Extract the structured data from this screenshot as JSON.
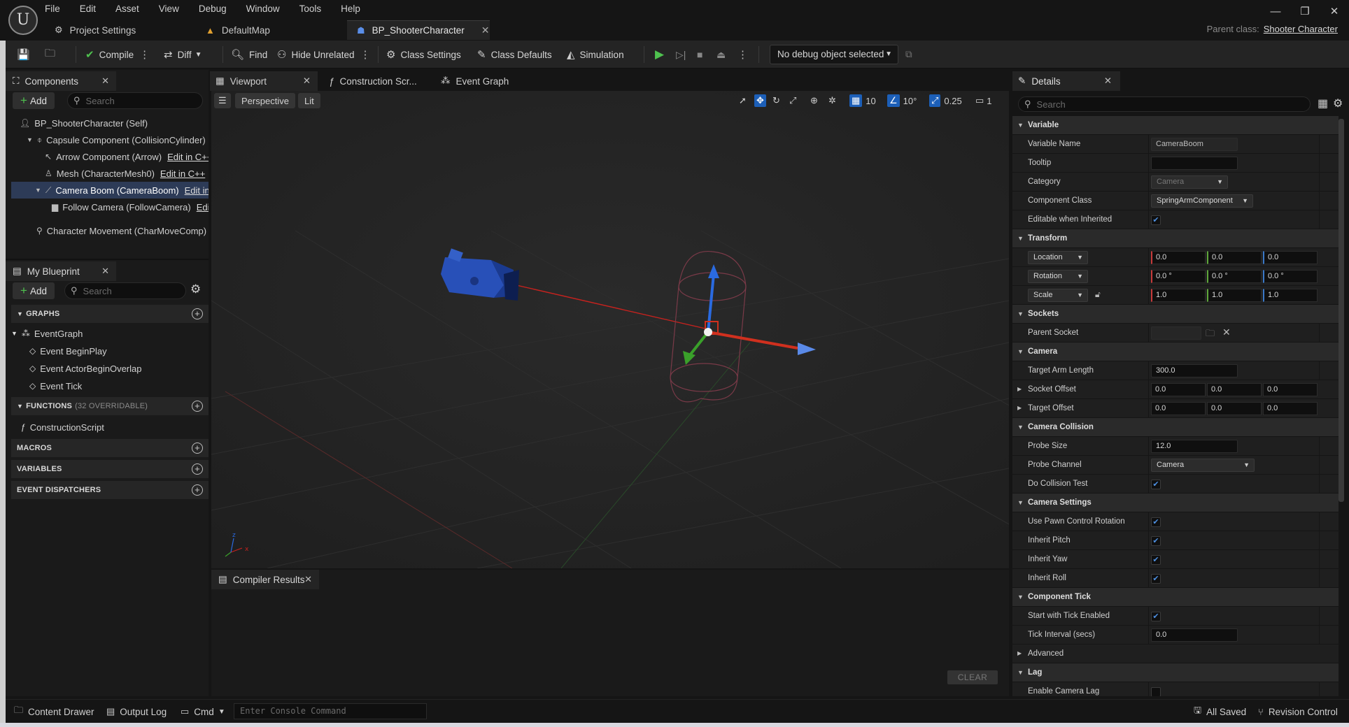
{
  "menu": [
    "File",
    "Edit",
    "Asset",
    "View",
    "Debug",
    "Window",
    "Tools",
    "Help"
  ],
  "doc_tabs": [
    {
      "label": "Project Settings",
      "icon": "gear-icon"
    },
    {
      "label": "DefaultMap",
      "icon": "level-icon"
    },
    {
      "label": "BP_ShooterCharacter",
      "icon": "blueprint-icon",
      "active": true
    }
  ],
  "parent_class": {
    "label": "Parent class:",
    "value": "Shooter Character"
  },
  "toolbar": {
    "compile": "Compile",
    "diff": "Diff",
    "find": "Find",
    "hide_unrelated": "Hide Unrelated",
    "class_settings": "Class Settings",
    "class_defaults": "Class Defaults",
    "simulation": "Simulation",
    "debug_object": "No debug object selected"
  },
  "components": {
    "tab": "Components",
    "add": "Add",
    "search_placeholder": "Search",
    "tree": [
      {
        "label": "BP_ShooterCharacter (Self)"
      },
      {
        "label": "Capsule Component (CollisionCylinder)"
      },
      {
        "label": "Arrow Component (Arrow)",
        "edit": "Edit in C++"
      },
      {
        "label": "Mesh (CharacterMesh0)",
        "edit": "Edit in C++"
      },
      {
        "label": "Camera Boom (CameraBoom)",
        "edit": "Edit in"
      },
      {
        "label": "Follow Camera (FollowCamera)",
        "edit": "Edit"
      },
      {
        "label": "Character Movement (CharMoveComp)"
      }
    ]
  },
  "my_blueprint": {
    "tab": "My Blueprint",
    "add": "Add",
    "search_placeholder": "Search",
    "graphs": "GRAPHS",
    "event_graph": "EventGraph",
    "events": [
      "Event BeginPlay",
      "Event ActorBeginOverlap",
      "Event Tick"
    ],
    "functions": "FUNCTIONS",
    "functions_sub": "(32 OVERRIDABLE)",
    "construction": "ConstructionScript",
    "macros": "MACROS",
    "variables": "VARIABLES",
    "dispatchers": "EVENT DISPATCHERS"
  },
  "center_tabs": [
    "Viewport",
    "Construction Scr...",
    "Event Graph"
  ],
  "viewport": {
    "perspective": "Perspective",
    "lit": "Lit",
    "grid_snap": "10",
    "rot_snap": "10°",
    "scale_snap": "0.25",
    "cam_speed": "1"
  },
  "compiler": {
    "tab": "Compiler Results",
    "clear": "CLEAR"
  },
  "details": {
    "tab": "Details",
    "search_placeholder": "Search",
    "variable": "Variable",
    "variable_name_label": "Variable Name",
    "variable_name": "CameraBoom",
    "tooltip_label": "Tooltip",
    "category_label": "Category",
    "category": "Camera",
    "component_class_label": "Component Class",
    "component_class": "SpringArmComponent",
    "editable_label": "Editable when Inherited",
    "transform": "Transform",
    "location": "Location",
    "rotation": "Rotation",
    "scale": "Scale",
    "loc": [
      "0.0",
      "0.0",
      "0.0"
    ],
    "rot": [
      "0.0 °",
      "0.0 °",
      "0.0 °"
    ],
    "scl": [
      "1.0",
      "1.0",
      "1.0"
    ],
    "sockets": "Sockets",
    "parent_socket": "Parent Socket",
    "camera": "Camera",
    "target_arm_length_label": "Target Arm Length",
    "target_arm_length": "300.0",
    "socket_offset_label": "Socket Offset",
    "socket_offset": [
      "0.0",
      "0.0",
      "0.0"
    ],
    "target_offset_label": "Target Offset",
    "target_offset": [
      "0.0",
      "0.0",
      "0.0"
    ],
    "camera_collision": "Camera Collision",
    "probe_size_label": "Probe Size",
    "probe_size": "12.0",
    "probe_channel_label": "Probe Channel",
    "probe_channel": "Camera",
    "do_collision_label": "Do Collision Test",
    "camera_settings": "Camera Settings",
    "use_pawn_label": "Use Pawn Control Rotation",
    "inherit_pitch": "Inherit Pitch",
    "inherit_yaw": "Inherit Yaw",
    "inherit_roll": "Inherit Roll",
    "component_tick": "Component Tick",
    "start_tick_label": "Start with Tick Enabled",
    "tick_interval_label": "Tick Interval (secs)",
    "tick_interval": "0.0",
    "advanced": "Advanced",
    "lag": "Lag",
    "enable_lag_label": "Enable Camera Lag"
  },
  "statusbar": {
    "content_drawer": "Content Drawer",
    "output_log": "Output Log",
    "cmd": "Cmd",
    "console_placeholder": "Enter Console Command",
    "all_saved": "All Saved",
    "revision_control": "Revision Control"
  },
  "colors": {
    "selection": "#2d3b57",
    "accent_green": "#4fc24f",
    "check_blue": "#4d8fe0"
  }
}
